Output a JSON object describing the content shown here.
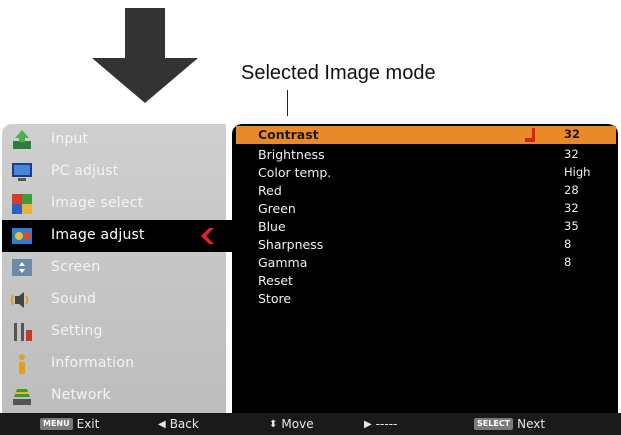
{
  "annotation": {
    "label": "Selected Image mode"
  },
  "sidebar": {
    "items": [
      {
        "label": "Input",
        "icon": "input-icon"
      },
      {
        "label": "PC adjust",
        "icon": "pc-adjust-icon"
      },
      {
        "label": "Image select",
        "icon": "image-select-icon"
      },
      {
        "label": "Image adjust",
        "icon": "image-adjust-icon",
        "active": true
      },
      {
        "label": "Screen",
        "icon": "screen-icon"
      },
      {
        "label": "Sound",
        "icon": "sound-icon"
      },
      {
        "label": "Setting",
        "icon": "setting-icon"
      },
      {
        "label": "Information",
        "icon": "information-icon"
      },
      {
        "label": "Network",
        "icon": "network-icon"
      }
    ]
  },
  "panel": {
    "rows": [
      {
        "name": "Contrast",
        "value": "32",
        "selected": true
      },
      {
        "name": "Brightness",
        "value": "32"
      },
      {
        "name": "Color temp.",
        "value": "High"
      },
      {
        "name": "Red",
        "value": "28"
      },
      {
        "name": "Green",
        "value": "32"
      },
      {
        "name": "Blue",
        "value": "35"
      },
      {
        "name": "Sharpness",
        "value": "8"
      },
      {
        "name": "Gamma",
        "value": "8"
      },
      {
        "name": "Reset",
        "value": ""
      },
      {
        "name": "Store",
        "value": ""
      }
    ]
  },
  "statusbar": {
    "exit_key": "MENU",
    "exit_label": "Exit",
    "back_label": "Back",
    "move_label": "Move",
    "right_label": "-----",
    "next_key": "SELECT",
    "next_label": "Next"
  },
  "colors": {
    "highlight": "#e98a2a",
    "sidebar_bg": "#c6c6c6",
    "panel_bg": "#000000",
    "active_arrow": "#e8202a"
  }
}
